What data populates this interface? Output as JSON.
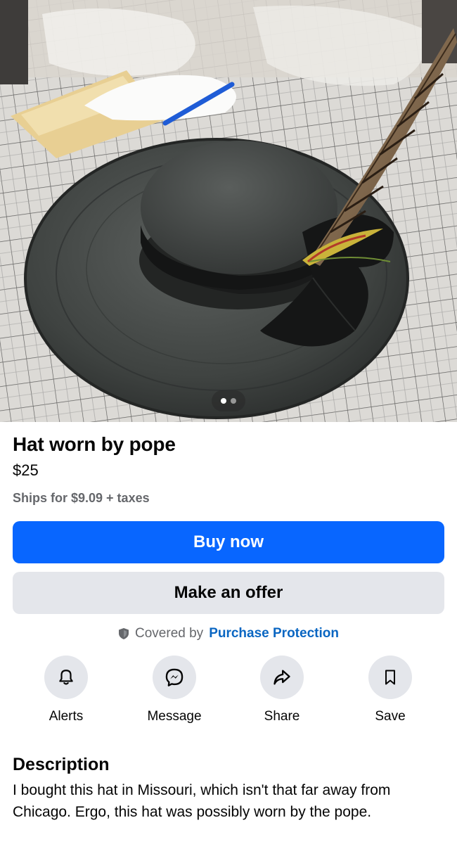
{
  "listing": {
    "title": "Hat worn by pope",
    "price": "$25",
    "shipping": "Ships for $9.09 + taxes",
    "photo": {
      "image_count": 2,
      "active_index": 0
    }
  },
  "buttons": {
    "buy_now": "Buy now",
    "make_offer": "Make an offer"
  },
  "protection": {
    "prefix": "Covered by",
    "link": "Purchase Protection"
  },
  "actions": [
    {
      "label": "Alerts",
      "icon": "bell-icon"
    },
    {
      "label": "Message",
      "icon": "messenger-icon"
    },
    {
      "label": "Share",
      "icon": "share-arrow-icon"
    },
    {
      "label": "Save",
      "icon": "bookmark-icon"
    }
  ],
  "description": {
    "heading": "Description",
    "text": "I bought this hat in Missouri, which isn't that far away from Chicago. Ergo, this hat was possibly worn by the pope."
  },
  "colors": {
    "primary": "#0866ff",
    "secondary_bg": "#e4e6eb",
    "link": "#0a66c2",
    "muted_text": "#65676b"
  }
}
